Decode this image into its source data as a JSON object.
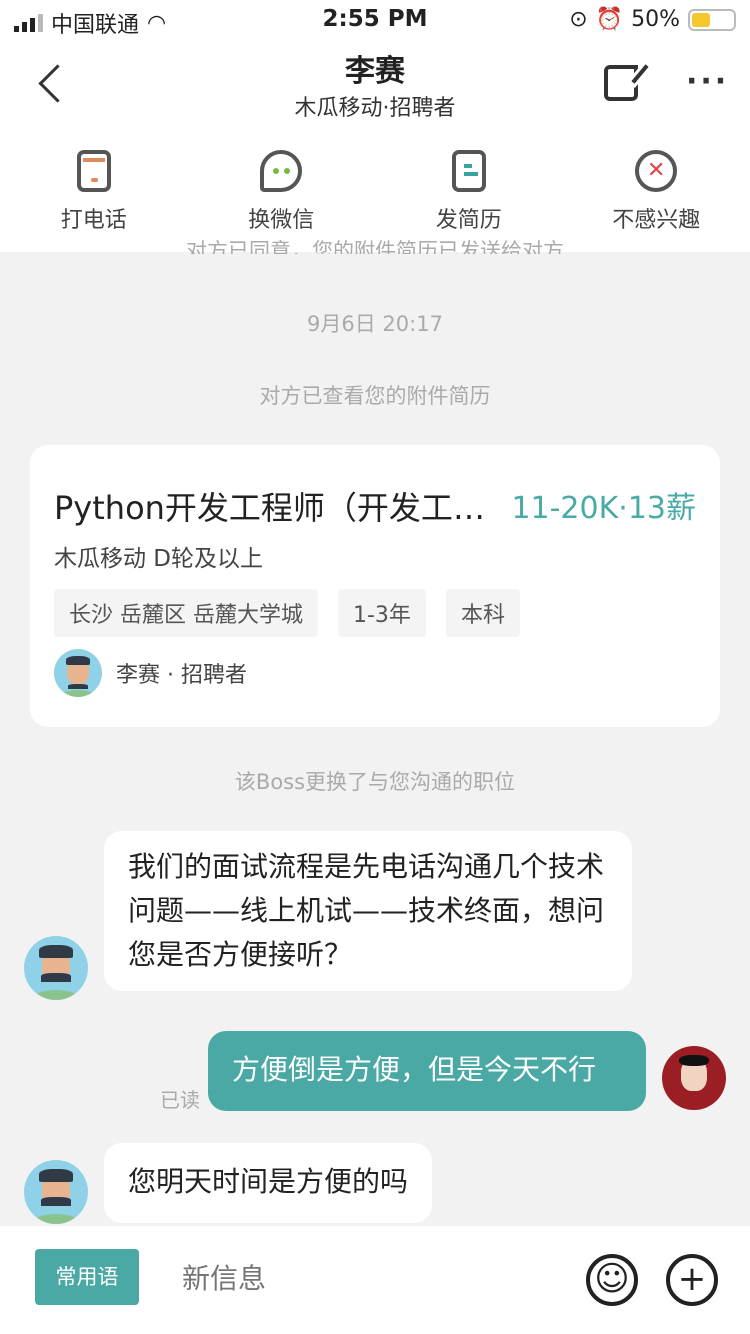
{
  "status": {
    "carrier": "中国联通",
    "time": "2:55 PM",
    "battery": "50%",
    "battery_level": 0.5
  },
  "header": {
    "title": "李赛",
    "subtitle": "木瓜移动·招聘者"
  },
  "actions": [
    {
      "label": "打电话",
      "icon": "phone-icon"
    },
    {
      "label": "换微信",
      "icon": "wechat-icon"
    },
    {
      "label": "发简历",
      "icon": "resume-icon"
    },
    {
      "label": "不感兴趣",
      "icon": "not-interested-icon"
    }
  ],
  "chat": {
    "clipped_notice": "对方已同意，您的附件简历已发送给对方",
    "timestamp": "9月6日 20:17",
    "viewed_notice": "对方已查看您的附件简历",
    "job_card": {
      "title": "Python开发工程师（开发工程师）",
      "salary": "11-20K·13薪",
      "company": "木瓜移动 D轮及以上",
      "tags": [
        "长沙 岳麓区 岳麓大学城",
        "1-3年",
        "本科"
      ],
      "recruiter": "李赛 · 招聘者"
    },
    "changed_notice": "该Boss更换了与您沟通的职位",
    "messages": [
      {
        "from": "them",
        "text": "我们的面试流程是先电话沟通几个技术问题——线上机试——技术终面，想问您是否方便接听？"
      },
      {
        "from": "me",
        "text": "方便倒是方便，但是今天不行",
        "status": "已读"
      },
      {
        "from": "them",
        "text": "您明天时间是方便的吗"
      }
    ]
  },
  "input": {
    "quick_label": "常用语",
    "placeholder": "新信息",
    "emoji": "☺",
    "plus": "+"
  }
}
